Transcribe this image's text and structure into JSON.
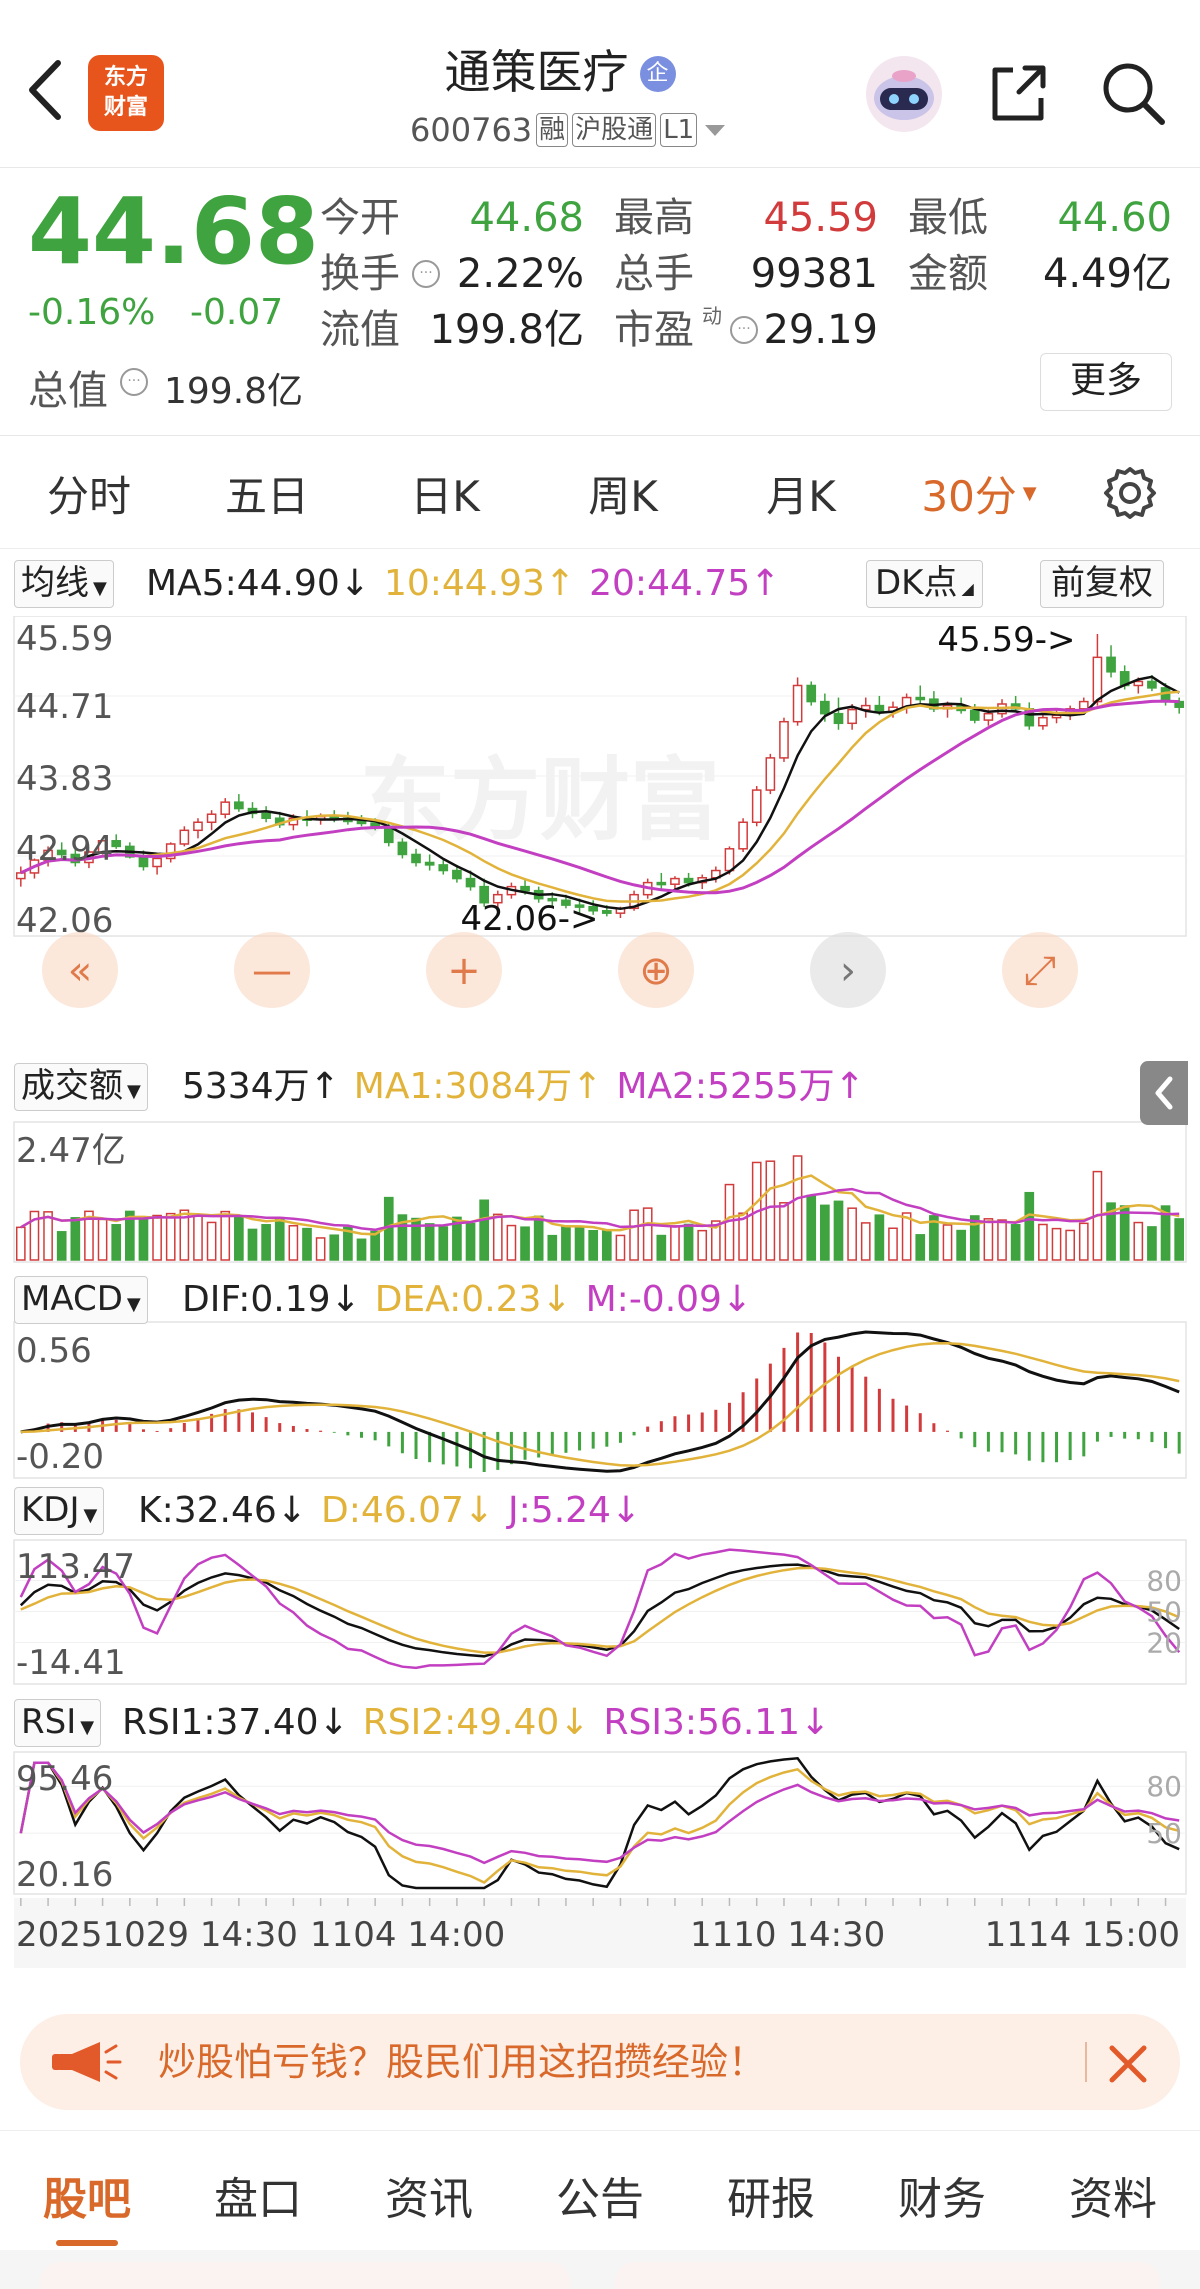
{
  "header": {
    "back_icon": "chevron-left-icon",
    "logo_text": "东方\n财富",
    "stock_name": "通策医疗",
    "badge": "企",
    "code": "600763",
    "tags": [
      "融",
      "沪股通",
      "L1"
    ],
    "assistant_icon": "robot-icon",
    "share_icon": "share-icon",
    "search_icon": "search-icon"
  },
  "quote": {
    "price": "44.68",
    "change_pct": "-0.16%",
    "change": "-0.07",
    "market_cap_label": "总值",
    "market_cap": "199.8亿",
    "stats": [
      {
        "label": "今开",
        "value": "44.68",
        "color": "#3fa33f"
      },
      {
        "label": "最高",
        "value": "45.59",
        "color": "#d23b3b"
      },
      {
        "label": "最低",
        "value": "44.60",
        "color": "#3fa33f"
      },
      {
        "label": "换手",
        "value": "2.22%",
        "color": "#222222"
      },
      {
        "label": "总手",
        "value": "99381",
        "color": "#222222"
      },
      {
        "label": "金额",
        "value": "4.49亿",
        "color": "#222222"
      },
      {
        "label": "流值",
        "value": "199.8亿",
        "color": "#222222"
      },
      {
        "label": "市盈",
        "value": "29.19",
        "color": "#222222"
      }
    ],
    "pe_superscript": "动",
    "more_label": "更多"
  },
  "period_tabs": [
    {
      "label": "分时",
      "active": false
    },
    {
      "label": "五日",
      "active": false
    },
    {
      "label": "日K",
      "active": false
    },
    {
      "label": "周K",
      "active": false
    },
    {
      "label": "月K",
      "active": false
    },
    {
      "label": "30分",
      "active": true
    }
  ],
  "settings_icon": "gear-icon",
  "kline": {
    "indicator_select": "均线",
    "ma_legend": [
      {
        "text": "MA5:44.90↓",
        "color": "#222222"
      },
      {
        "text": "10:44.93↑",
        "color": "#e2b33a"
      },
      {
        "text": "20:44.75↑",
        "color": "#c23fc2"
      }
    ],
    "dk_button": "DK点",
    "fq_button": "前复权",
    "y_labels": [
      "45.59",
      "44.71",
      "43.83",
      "42.94",
      "42.06"
    ],
    "high_marker": "45.59->",
    "low_marker": "42.06->",
    "watermark": "东方财富",
    "controls": [
      "double-chevron-left-icon",
      "minus-icon",
      "plus-icon",
      "zoom-in-icon",
      "chevron-right-icon",
      "expand-icon"
    ]
  },
  "volume": {
    "select": "成交额",
    "legend": [
      {
        "text": "5334万↑",
        "color": "#222222"
      },
      {
        "text": "MA1:3084万↑",
        "color": "#e2b33a"
      },
      {
        "text": "MA2:5255万↑",
        "color": "#c23fc2"
      }
    ],
    "y_label": "2.47亿",
    "collapse_icon": "chevron-left-icon"
  },
  "macd": {
    "select": "MACD",
    "legend": [
      {
        "text": "DIF:0.19↓",
        "color": "#222222"
      },
      {
        "text": "DEA:0.23↓",
        "color": "#e2b33a"
      },
      {
        "text": "M:-0.09↓",
        "color": "#c23fc2"
      }
    ],
    "y_labels": [
      "0.56",
      "-0.20"
    ]
  },
  "kdj": {
    "select": "KDJ",
    "legend": [
      {
        "text": "K:32.46↓",
        "color": "#222222"
      },
      {
        "text": "D:46.07↓",
        "color": "#e2b33a"
      },
      {
        "text": "J:5.24↓",
        "color": "#c23fc2"
      }
    ],
    "y_labels": [
      "113.47",
      "-14.41"
    ],
    "right_labels": [
      "80",
      "50",
      "20"
    ]
  },
  "rsi": {
    "select": "RSI",
    "legend": [
      {
        "text": "RSI1:37.40↓",
        "color": "#222222"
      },
      {
        "text": "RSI2:49.40↓",
        "color": "#e2b33a"
      },
      {
        "text": "RSI3:56.11↓",
        "color": "#c23fc2"
      }
    ],
    "y_labels": [
      "95.46",
      "20.16"
    ],
    "right_labels": [
      "80",
      "50"
    ]
  },
  "x_axis_labels": [
    "20251029 14:30",
    "1104 14:00",
    "1110 14:30",
    "1114 15:00"
  ],
  "banner": {
    "icon": "megaphone-icon",
    "text": "炒股怕亏钱？股民们用这招攒经验！",
    "close_icon": "close-icon"
  },
  "bottom_tabs": [
    {
      "label": "股吧",
      "active": true
    },
    {
      "label": "盘口",
      "active": false
    },
    {
      "label": "资讯",
      "active": false
    },
    {
      "label": "公告",
      "active": false
    },
    {
      "label": "研报",
      "active": false
    },
    {
      "label": "财务",
      "active": false
    },
    {
      "label": "资料",
      "active": false
    }
  ],
  "colors": {
    "up": "#d23b3b",
    "down": "#3fa33f",
    "active_tab": "#d8692a",
    "ma10": "#e2b33a",
    "ma20": "#c23fc2"
  },
  "chart_data": {
    "type": "candlestick",
    "ohlc": [
      [
        42.55,
        42.7,
        42.45,
        42.62
      ],
      [
        42.62,
        42.8,
        42.55,
        42.78
      ],
      [
        42.78,
        42.95,
        42.7,
        42.9
      ],
      [
        42.9,
        43.0,
        42.8,
        42.85
      ],
      [
        42.85,
        42.95,
        42.7,
        42.75
      ],
      [
        42.75,
        42.9,
        42.68,
        42.88
      ],
      [
        42.88,
        43.05,
        42.85,
        43.02
      ],
      [
        43.02,
        43.1,
        42.92,
        42.95
      ],
      [
        42.95,
        43.0,
        42.8,
        42.82
      ],
      [
        42.82,
        42.9,
        42.65,
        42.7
      ],
      [
        42.7,
        42.85,
        42.6,
        42.8
      ],
      [
        42.8,
        43.0,
        42.75,
        42.98
      ],
      [
        42.98,
        43.2,
        42.95,
        43.15
      ],
      [
        43.15,
        43.3,
        43.05,
        43.25
      ],
      [
        43.25,
        43.4,
        43.15,
        43.35
      ],
      [
        43.35,
        43.55,
        43.3,
        43.5
      ],
      [
        43.5,
        43.6,
        43.38,
        43.42
      ],
      [
        43.42,
        43.5,
        43.3,
        43.36
      ],
      [
        43.36,
        43.45,
        43.25,
        43.3
      ],
      [
        43.3,
        43.38,
        43.18,
        43.22
      ],
      [
        43.22,
        43.35,
        43.15,
        43.3
      ],
      [
        43.3,
        43.4,
        43.2,
        43.28
      ],
      [
        43.28,
        43.36,
        43.22,
        43.32
      ],
      [
        43.32,
        43.4,
        43.25,
        43.3
      ],
      [
        43.3,
        43.38,
        43.22,
        43.26
      ],
      [
        43.26,
        43.34,
        43.2,
        43.24
      ],
      [
        43.24,
        43.3,
        43.15,
        43.2
      ],
      [
        43.2,
        43.25,
        42.95,
        43.0
      ],
      [
        43.0,
        43.05,
        42.8,
        42.85
      ],
      [
        42.85,
        42.92,
        42.7,
        42.75
      ],
      [
        42.75,
        42.85,
        42.65,
        42.72
      ],
      [
        42.72,
        42.8,
        42.6,
        42.65
      ],
      [
        42.65,
        42.72,
        42.5,
        42.55
      ],
      [
        42.55,
        42.65,
        42.4,
        42.45
      ],
      [
        42.45,
        42.55,
        42.2,
        42.25
      ],
      [
        42.25,
        42.4,
        42.15,
        42.35
      ],
      [
        42.35,
        42.5,
        42.3,
        42.45
      ],
      [
        42.45,
        42.55,
        42.35,
        42.4
      ],
      [
        42.4,
        42.45,
        42.25,
        42.3
      ],
      [
        42.3,
        42.38,
        42.2,
        42.28
      ],
      [
        42.28,
        42.35,
        42.18,
        42.22
      ],
      [
        42.22,
        42.3,
        42.12,
        42.2
      ],
      [
        42.2,
        42.28,
        42.1,
        42.15
      ],
      [
        42.15,
        42.22,
        42.08,
        42.12
      ],
      [
        42.12,
        42.2,
        42.06,
        42.18
      ],
      [
        42.18,
        42.4,
        42.15,
        42.35
      ],
      [
        42.35,
        42.55,
        42.3,
        42.5
      ],
      [
        42.5,
        42.62,
        42.42,
        42.48
      ],
      [
        42.48,
        42.58,
        42.4,
        42.55
      ],
      [
        42.55,
        42.62,
        42.45,
        42.5
      ],
      [
        42.5,
        42.6,
        42.42,
        42.56
      ],
      [
        42.56,
        42.7,
        42.5,
        42.65
      ],
      [
        42.65,
        42.95,
        42.6,
        42.92
      ],
      [
        42.92,
        43.3,
        42.88,
        43.25
      ],
      [
        43.25,
        43.7,
        43.2,
        43.65
      ],
      [
        43.65,
        44.1,
        43.6,
        44.05
      ],
      [
        44.05,
        44.55,
        44.0,
        44.5
      ],
      [
        44.5,
        45.05,
        44.45,
        44.95
      ],
      [
        44.95,
        45.0,
        44.7,
        44.75
      ],
      [
        44.75,
        44.85,
        44.5,
        44.6
      ],
      [
        44.6,
        44.8,
        44.4,
        44.48
      ],
      [
        44.48,
        44.72,
        44.4,
        44.65
      ],
      [
        44.65,
        44.8,
        44.55,
        44.7
      ],
      [
        44.7,
        44.82,
        44.58,
        44.62
      ],
      [
        44.62,
        44.75,
        44.55,
        44.68
      ],
      [
        44.68,
        44.85,
        44.6,
        44.8
      ],
      [
        44.8,
        44.95,
        44.72,
        44.78
      ],
      [
        44.78,
        44.88,
        44.62,
        44.66
      ],
      [
        44.66,
        44.75,
        44.55,
        44.7
      ],
      [
        44.7,
        44.8,
        44.6,
        44.64
      ],
      [
        44.64,
        44.72,
        44.48,
        44.52
      ],
      [
        44.52,
        44.65,
        44.45,
        44.6
      ],
      [
        44.6,
        44.78,
        44.55,
        44.72
      ],
      [
        44.72,
        44.82,
        44.62,
        44.66
      ],
      [
        44.66,
        44.74,
        44.4,
        44.45
      ],
      [
        44.45,
        44.58,
        44.4,
        44.55
      ],
      [
        44.55,
        44.66,
        44.48,
        44.58
      ],
      [
        44.58,
        44.7,
        44.52,
        44.66
      ],
      [
        44.66,
        44.8,
        44.6,
        44.75
      ],
      [
        44.75,
        45.59,
        44.7,
        45.3
      ],
      [
        45.3,
        45.45,
        45.05,
        45.12
      ],
      [
        45.12,
        45.2,
        44.9,
        44.95
      ],
      [
        44.95,
        45.05,
        44.85,
        45.0
      ],
      [
        45.0,
        45.08,
        44.88,
        44.92
      ],
      [
        44.92,
        44.98,
        44.7,
        44.75
      ],
      [
        44.75,
        44.8,
        44.6,
        44.68
      ]
    ],
    "volume_max": "2.47亿",
    "x_labels": [
      "20251029 14:30",
      "1104 14:00",
      "1110 14:30",
      "1114 15:00"
    ]
  }
}
